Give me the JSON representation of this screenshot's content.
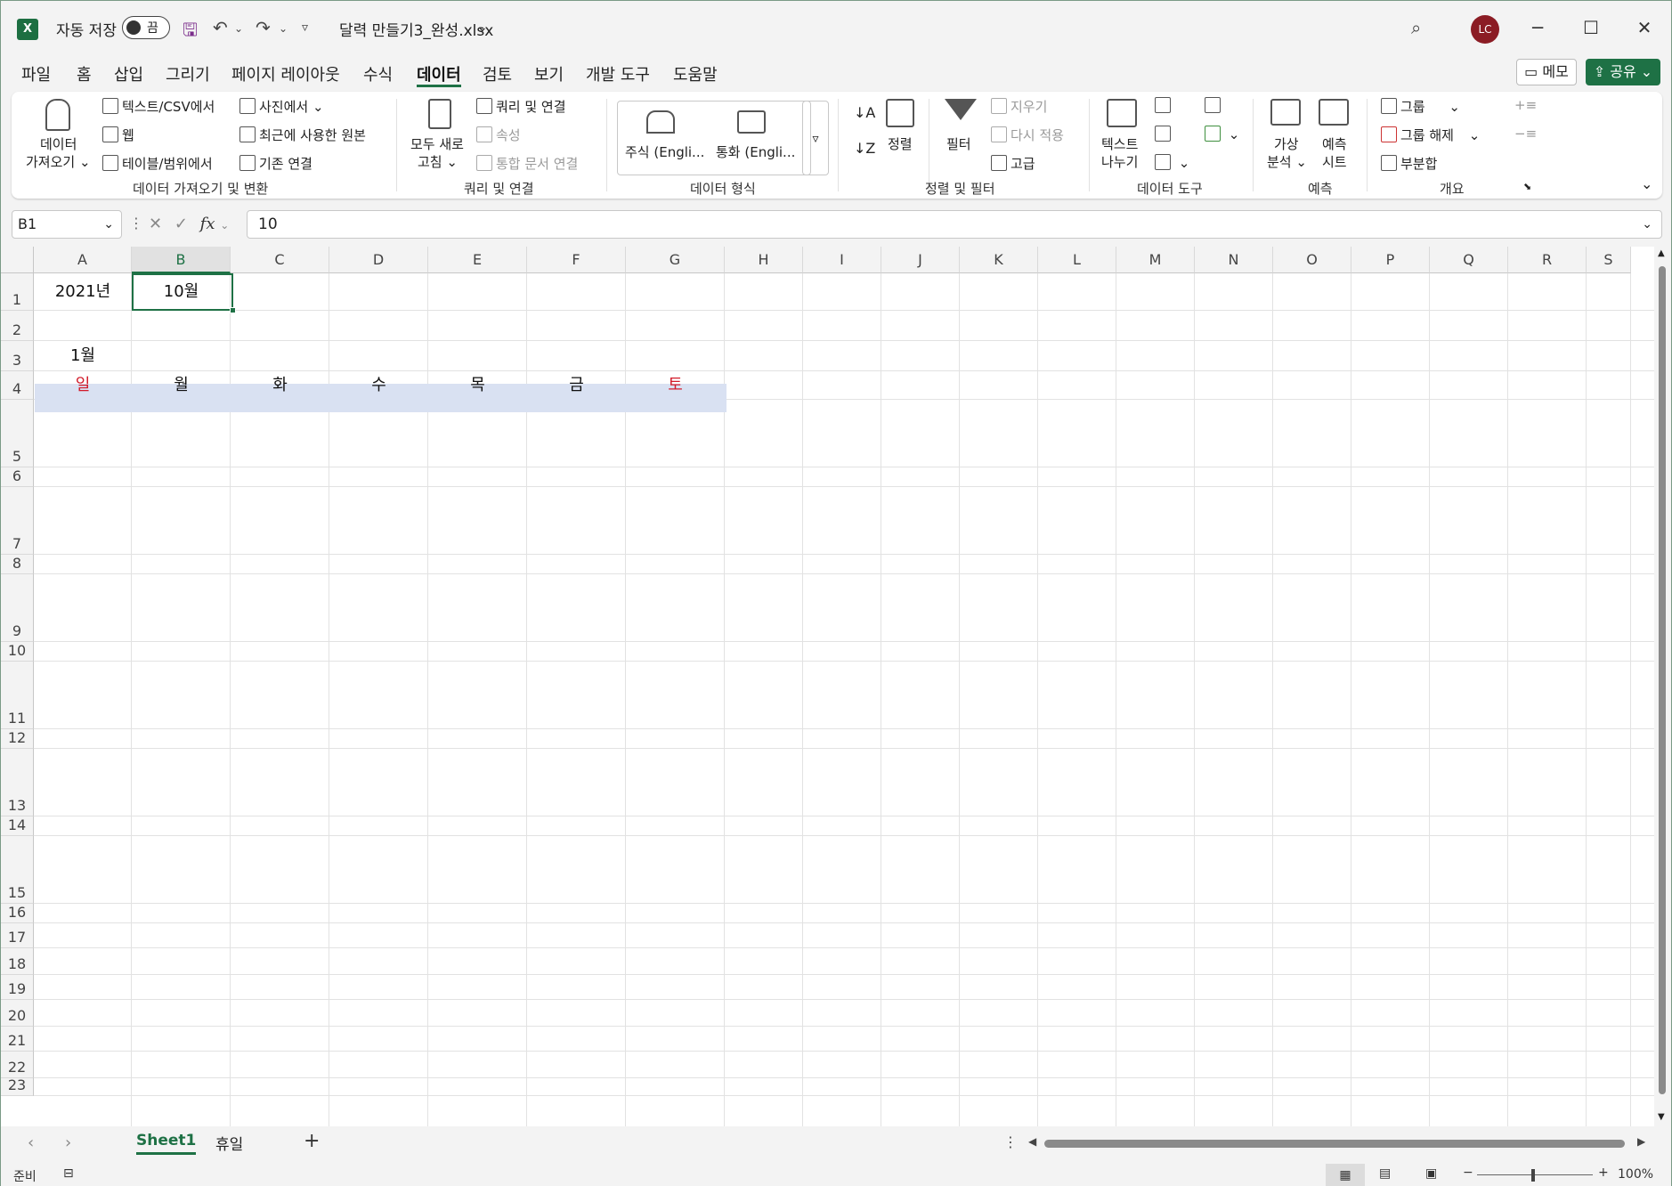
{
  "titlebar": {
    "app_icon": "excel-icon",
    "autosave_label": "자동 저장",
    "autosave_state": "끔",
    "filename": "달력 만들기3_완성.xlsx",
    "avatar_initials": "LC",
    "buttons": {
      "minimize": "─",
      "maximize": "☐",
      "close": "✕"
    }
  },
  "tabs": [
    "파일",
    "홈",
    "삽입",
    "그리기",
    "페이지 레이아웃",
    "수식",
    "데이터",
    "검토",
    "보기",
    "개발 도구",
    "도움말"
  ],
  "active_tab": "데이터",
  "actions": {
    "memo": "메모",
    "share": "공유"
  },
  "ribbon": {
    "get_data": {
      "big_button": "데이터\n가져오기",
      "big_l1": "데이터",
      "big_l2": "가져오기 ⌄",
      "text_csv": "텍스트/CSV에서",
      "web": "웹",
      "table_range": "테이블/범위에서",
      "from_picture": "사진에서 ⌄",
      "recent_sources": "최근에 사용한 원본",
      "existing_conn": "기존 연결",
      "label": "데이터 가져오기 및 변환"
    },
    "queries": {
      "refresh_l1": "모두 새로",
      "refresh_l2": "고침 ⌄",
      "queries_conn": "쿼리 및 연결",
      "properties": "속성",
      "workbook_links": "통합 문서 연결",
      "label": "쿼리 및 연결"
    },
    "data_types": {
      "stocks": "주식 (Engli...",
      "currencies": "통화 (Engli...",
      "label": "데이터 형식"
    },
    "sort_filter": {
      "sort": "정렬",
      "filter": "필터",
      "clear": "지우기",
      "reapply": "다시 적용",
      "advanced": "고급",
      "label": "정렬 및 필터"
    },
    "data_tools": {
      "text_to_cols_l1": "텍스트",
      "text_to_cols_l2": "나누기",
      "label": "데이터 도구"
    },
    "forecast": {
      "whatif_l1": "가상",
      "whatif_l2": "분석 ⌄",
      "sheet_l1": "예측",
      "sheet_l2": "시트",
      "label": "예측"
    },
    "outline": {
      "group": "그룹",
      "ungroup": "그룹 해제",
      "subtotal": "부분합",
      "label": "개요"
    }
  },
  "formula_bar": {
    "name_box": "B1",
    "fx": "fx",
    "value": "10"
  },
  "columns": [
    "A",
    "B",
    "C",
    "D",
    "E",
    "F",
    "G",
    "H",
    "I",
    "J",
    "K",
    "L",
    "M",
    "N",
    "O",
    "P",
    "Q",
    "R",
    "S"
  ],
  "rows": [
    "1",
    "2",
    "3",
    "4",
    "5",
    "6",
    "7",
    "8",
    "9",
    "10",
    "11",
    "12",
    "13",
    "14",
    "15",
    "16",
    "17",
    "18",
    "19",
    "20",
    "21",
    "22",
    "23"
  ],
  "cells": {
    "A1": "2021년",
    "B1": "10월",
    "A3": "1월",
    "weekdays": [
      "일",
      "월",
      "화",
      "수",
      "목",
      "금",
      "토"
    ]
  },
  "colors": {
    "accent": "#1e7145",
    "weekday_header_bg": "#d9e1f2",
    "weekend_text": "#d21b2a"
  },
  "sheets": [
    "Sheet1",
    "휴일"
  ],
  "active_sheet": "Sheet1",
  "status": {
    "ready": "준비",
    "zoom": "100%"
  }
}
